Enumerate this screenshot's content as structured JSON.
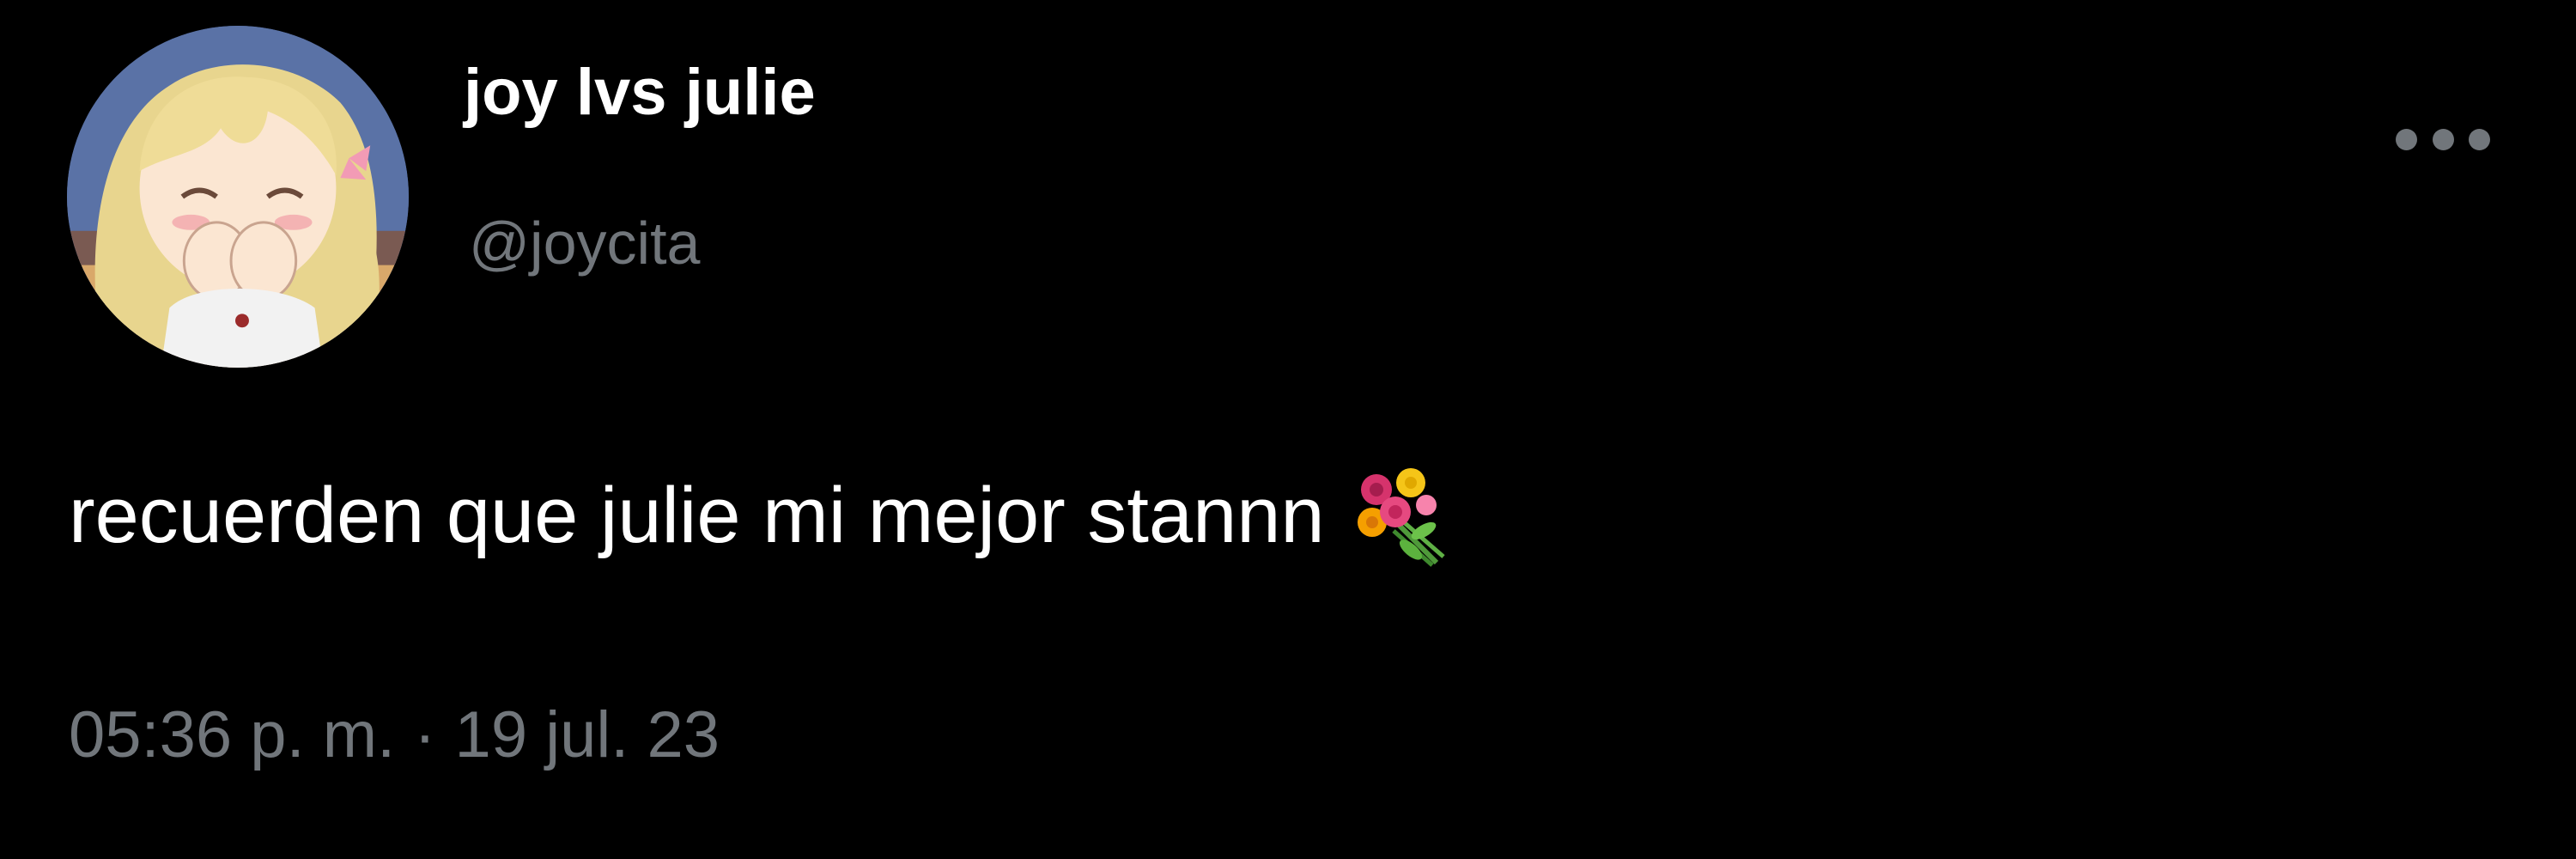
{
  "tweet": {
    "display_name": "joy lvs julie",
    "handle": "@joycita",
    "text": "recuerden que julie mi mejor stannn",
    "text_emoji": "bouquet-icon",
    "time": "05:36 p. m.",
    "separator": "·",
    "date": "19 jul. 23",
    "more_icon": "more-options-icon"
  },
  "colors": {
    "background": "#000000",
    "primary_text": "#ffffff",
    "secondary_text": "#71767b"
  }
}
